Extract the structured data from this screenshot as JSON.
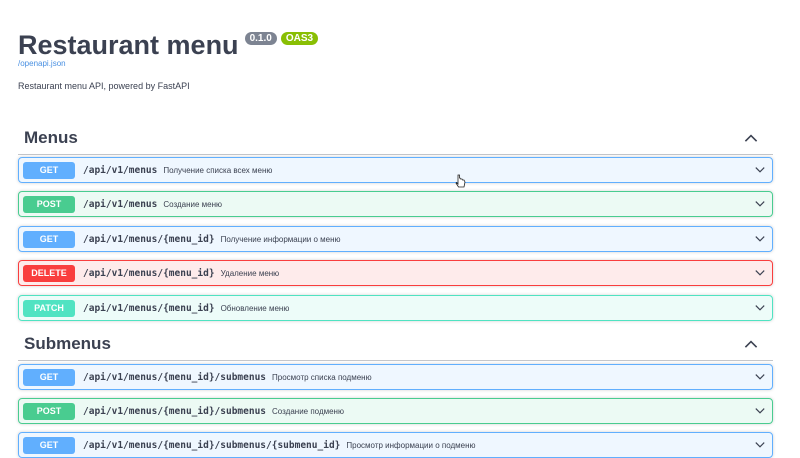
{
  "info": {
    "title": "Restaurant menu",
    "version": "0.1.0",
    "oas": "OAS3",
    "spec_link": "/openapi.json",
    "description": "Restaurant menu API, powered by FastAPI"
  },
  "tags": [
    {
      "name": "Menus",
      "operations": [
        {
          "method": "GET",
          "path": "/api/v1/menus",
          "summary": "Получение списка всех меню"
        },
        {
          "method": "POST",
          "path": "/api/v1/menus",
          "summary": "Создание меню"
        },
        {
          "method": "GET",
          "path": "/api/v1/menus/{menu_id}",
          "summary": "Получение информации о меню"
        },
        {
          "method": "DELETE",
          "path": "/api/v1/menus/{menu_id}",
          "summary": "Удаление меню"
        },
        {
          "method": "PATCH",
          "path": "/api/v1/menus/{menu_id}",
          "summary": "Обновление меню"
        }
      ]
    },
    {
      "name": "Submenus",
      "operations": [
        {
          "method": "GET",
          "path": "/api/v1/menus/{menu_id}/submenus",
          "summary": "Просмотр списка подменю"
        },
        {
          "method": "POST",
          "path": "/api/v1/menus/{menu_id}/submenus",
          "summary": "Создание подменю"
        },
        {
          "method": "GET",
          "path": "/api/v1/menus/{menu_id}/submenus/{submenu_id}",
          "summary": "Просмотр информации о подменю"
        }
      ]
    }
  ],
  "colors": {
    "get": "#61affe",
    "post": "#49cc90",
    "delete": "#f93e3e",
    "patch": "#50e3c2",
    "text": "#3b4151"
  },
  "icons": {
    "tag_toggle": "chevron-up-icon",
    "operation_toggle": "chevron-down-icon",
    "cursor": "mouse-pointer-icon"
  }
}
